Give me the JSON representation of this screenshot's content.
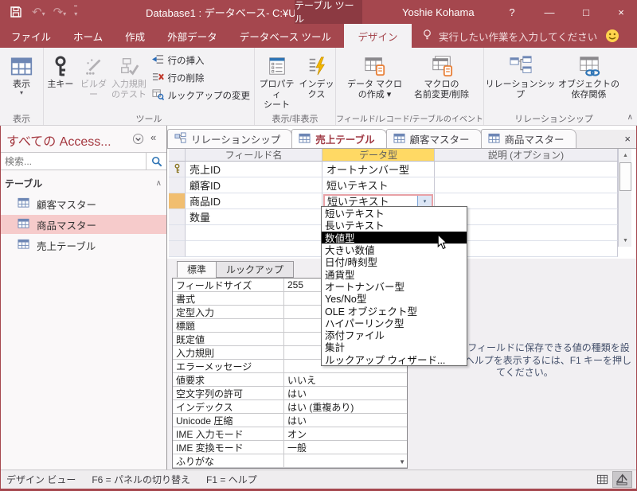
{
  "glyphs": {
    "caret": "▾",
    "undo": "↶",
    "redo": "↷",
    "collapse_left": "«",
    "chevron_up": "∧",
    "up": "▲",
    "down": "▼",
    "combo_chevron": "▾"
  },
  "titlebar": {
    "title": "Database1 : データベース- C:¥Users…",
    "contextual_tab": "テーブル ツール",
    "user": "Yoshie Kohama",
    "help": "?",
    "minimize": "—",
    "maximize": "□",
    "close": "×"
  },
  "ribbon_tabs": {
    "file": "ファイル",
    "home": "ホーム",
    "create": "作成",
    "external_data": "外部データ",
    "db_tools": "データベース ツール",
    "design": "デザイン",
    "tell_me": "実行したい作業を入力してください"
  },
  "ribbon": {
    "view": {
      "label": "表示",
      "group": "表示"
    },
    "tools": {
      "primary_key": "主キー",
      "builder": "ビルダー",
      "test_validation": "入力規則\nのテスト",
      "insert_rows": "行の挿入",
      "delete_rows": "行の削除",
      "modify_lookups": "ルックアップの変更",
      "group": "ツール"
    },
    "show_hide": {
      "property_sheet": "プロパティ\nシート",
      "indexes": "インデックス",
      "group": "表示/非表示"
    },
    "events": {
      "create_data_macros": "データ マクロ\nの作成 ▾",
      "rename_delete_macro": "マクロの\n名前変更/削除",
      "group": "フィールド/レコード/テーブルのイベント"
    },
    "relationships": {
      "relationships": "リレーションシップ",
      "object_dependencies": "オブジェクトの\n依存関係",
      "group": "リレーションシップ"
    }
  },
  "nav": {
    "title": "すべての Access...",
    "search_placeholder": "検索...",
    "section": "テーブル",
    "items": [
      {
        "label": "顧客マスター"
      },
      {
        "label": "商品マスター"
      },
      {
        "label": "売上テーブル"
      }
    ]
  },
  "doc_tabs": {
    "relationships": "リレーションシップ",
    "sales_table": "売上テーブル",
    "customer_master": "顧客マスター",
    "product_master": "商品マスター",
    "close": "×"
  },
  "design_grid": {
    "headers": {
      "field_name": "フィールド名",
      "data_type": "データ型",
      "description": "説明 (オプション)"
    },
    "rows": [
      {
        "field": "売上ID",
        "type": "オートナンバー型"
      },
      {
        "field": "顧客ID",
        "type": "短いテキスト"
      },
      {
        "field": "商品ID",
        "type": "短いテキスト"
      },
      {
        "field": "数量",
        "type": ""
      }
    ]
  },
  "type_dropdown": {
    "highlighted": "数値型",
    "items": [
      "短いテキスト",
      "長いテキスト",
      "数値型",
      "大きい数値",
      "日付/時刻型",
      "通貨型",
      "オートナンバー型",
      "Yes/No型",
      "OLE オブジェクト型",
      "ハイパーリンク型",
      "添付ファイル",
      "集計",
      "ルックアップ ウィザード..."
    ]
  },
  "properties": {
    "tab_standard": "標準",
    "tab_lookup": "ルックアップ",
    "rows": [
      {
        "label": "フィールドサイズ",
        "value": "255"
      },
      {
        "label": "書式",
        "value": ""
      },
      {
        "label": "定型入力",
        "value": ""
      },
      {
        "label": "標題",
        "value": ""
      },
      {
        "label": "既定値",
        "value": ""
      },
      {
        "label": "入力規則",
        "value": ""
      },
      {
        "label": "エラーメッセージ",
        "value": ""
      },
      {
        "label": "値要求",
        "value": "いいえ"
      },
      {
        "label": "空文字列の許可",
        "value": "はい"
      },
      {
        "label": "インデックス",
        "value": "はい (重複あり)"
      },
      {
        "label": "Unicode 圧縮",
        "value": "はい"
      },
      {
        "label": "IME 入力モード",
        "value": "オン"
      },
      {
        "label": "IME 変換モード",
        "value": "一般"
      },
      {
        "label": "ふりがな",
        "value": ""
      }
    ]
  },
  "help_panel": {
    "text": "データ型はフィールドに保存できる値の種類を設定します。ヘルプを表示するには、F1 キーを押してください。"
  },
  "status_bar": {
    "view_mode": "デザイン ビュー",
    "f6": "F6 = パネルの切り替え",
    "f1": "F1 = ヘルプ"
  },
  "colors": {
    "accent": "#A5474E",
    "contextual_tab": "#8C3A42",
    "data_type_header": "#FFD964",
    "nav_selection": "#F6CBCB",
    "row_selector_active": "#F1BE70",
    "dropdown_highlight": "#000000"
  }
}
